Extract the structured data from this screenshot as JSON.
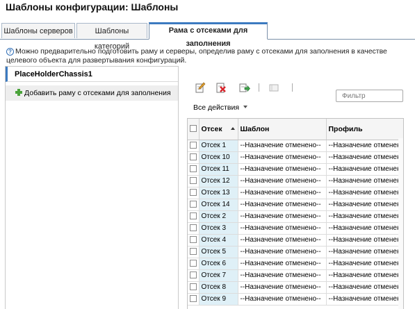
{
  "page": {
    "title": "Шаблоны конфигурации: Шаблоны"
  },
  "tabs": [
    {
      "label": "Шаблоны серверов",
      "active": false
    },
    {
      "label": "Шаблоны категорий",
      "active": false
    },
    {
      "label": "Рама с отсеками для заполнения",
      "active": true
    }
  ],
  "info": {
    "text": "Можно предварительно подготовить раму и серверы, определив раму с отсеками для заполнения в качестве целевого объекта для развертывания конфигураций."
  },
  "left_panel": {
    "chassis_name": "PlaceHolderChassis1",
    "add_label": "Добавить раму с отсеками для заполнения"
  },
  "toolbar": {
    "icons": [
      "edit-icon",
      "delete-icon",
      "deploy-icon",
      "unassign-icon"
    ],
    "filter_placeholder": "Фильтр",
    "all_actions_label": "Все действия"
  },
  "table": {
    "headers": {
      "bay": "Отсек",
      "template": "Шаблон",
      "profile": "Профиль"
    },
    "rows": [
      {
        "bay": "Отсек 1",
        "template": "--Назначение отменено--",
        "profile": "--Назначение отменено--"
      },
      {
        "bay": "Отсек 10",
        "template": "--Назначение отменено--",
        "profile": "--Назначение отменено--"
      },
      {
        "bay": "Отсек 11",
        "template": "--Назначение отменено--",
        "profile": "--Назначение отменено--"
      },
      {
        "bay": "Отсек 12",
        "template": "--Назначение отменено--",
        "profile": "--Назначение отменено--"
      },
      {
        "bay": "Отсек 13",
        "template": "--Назначение отменено--",
        "profile": "--Назначение отменено--"
      },
      {
        "bay": "Отсек 14",
        "template": "--Назначение отменено--",
        "profile": "--Назначение отменено--"
      },
      {
        "bay": "Отсек 2",
        "template": "--Назначение отменено--",
        "profile": "--Назначение отменено--"
      },
      {
        "bay": "Отсек 3",
        "template": "--Назначение отменено--",
        "profile": "--Назначение отменено--"
      },
      {
        "bay": "Отсек 4",
        "template": "--Назначение отменено--",
        "profile": "--Назначение отменено--"
      },
      {
        "bay": "Отсек 5",
        "template": "--Назначение отменено--",
        "profile": "--Назначение отменено--"
      },
      {
        "bay": "Отсек 6",
        "template": "--Назначение отменено--",
        "profile": "--Назначение отменено--"
      },
      {
        "bay": "Отсек 7",
        "template": "--Назначение отменено--",
        "profile": "--Назначение отменено--"
      },
      {
        "bay": "Отсек 8",
        "template": "--Назначение отменено--",
        "profile": "--Назначение отменено--"
      },
      {
        "bay": "Отсек 9",
        "template": "--Назначение отменено--",
        "profile": "--Назначение отменено--"
      }
    ]
  },
  "colors": {
    "accent": "#3c7ac0",
    "bay_cell": "#dff0f7",
    "add_icon": "#4aa33a"
  }
}
